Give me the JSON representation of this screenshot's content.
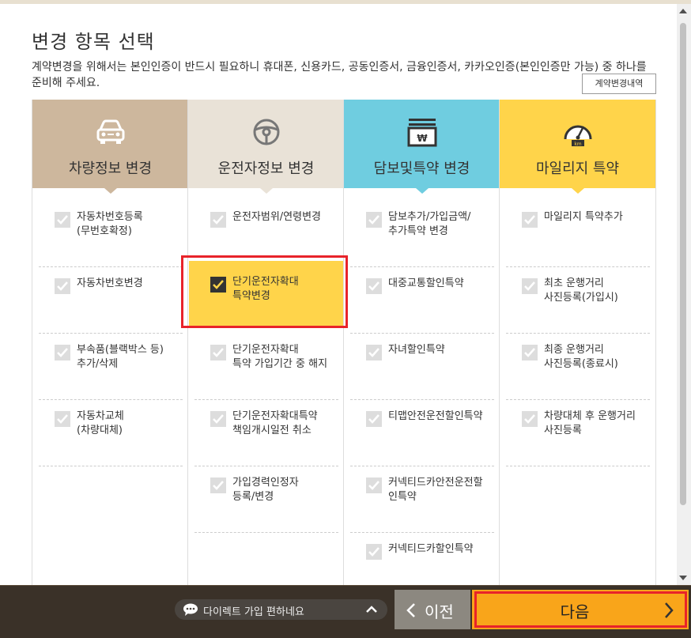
{
  "page": {
    "title": "변경 항목 선택",
    "notice": "계약변경을 위해서는 본인인증이 반드시 필요하니 휴대폰, 신용카드, 공동인증서, 금융인증서, 카카오인증(본인인증만 가능) 중 하나를 준비해 주세요.",
    "history_button": "계약변경내역"
  },
  "columns": [
    {
      "label": "차량정보 변경",
      "icon": "car-icon",
      "color": "#cdb79d",
      "items": [
        {
          "label": "자동차번호등록\n(무번호확정)",
          "checked": false
        },
        {
          "label": "자동차번호변경",
          "checked": false
        },
        {
          "label": "부속품(블랙박스 등)\n추가/삭제",
          "checked": false
        },
        {
          "label": "자동차교체\n(차량대체)",
          "checked": false
        }
      ]
    },
    {
      "label": "운전자정보 변경",
      "icon": "steering-wheel-icon",
      "color": "#e9e2d7",
      "items": [
        {
          "label": "운전자범위/연령변경",
          "checked": false
        },
        {
          "label": "단기운전자확대\n특약변경",
          "checked": true
        },
        {
          "label": "단기운전자확대\n특약 가입기간 중 해지",
          "checked": false
        },
        {
          "label": "단기운전자확대특약\n책임개시일전 취소",
          "checked": false
        },
        {
          "label": "가입경력인정자\n등록/변경",
          "checked": false
        }
      ]
    },
    {
      "label": "담보및특약 변경",
      "icon": "money-bill-icon",
      "color": "#6fcde0",
      "items": [
        {
          "label": "담보추가/가입금액/\n추가특약 변경",
          "checked": false
        },
        {
          "label": "대중교통할인특약",
          "checked": false
        },
        {
          "label": "자녀할인특약",
          "checked": false
        },
        {
          "label": "티맵안전운전할인특약",
          "checked": false
        },
        {
          "label": "커넥티드카안전운전할\n인특약",
          "checked": false
        },
        {
          "label": "커넥티드카할인특약",
          "checked": false
        }
      ]
    },
    {
      "label": "마일리지 특약",
      "icon": "speedometer-icon",
      "color": "#ffd44a",
      "items": [
        {
          "label": "마일리지 특약추가",
          "checked": false
        },
        {
          "label": "최초 운행거리\n사진등록(가입시)",
          "checked": false
        },
        {
          "label": "최종 운행거리\n사진등록(종료시)",
          "checked": false
        },
        {
          "label": "차량대체 후 운행거리\n사진등록",
          "checked": false
        }
      ]
    }
  ],
  "footer": {
    "chat_label": "다이렉트 가입 편하네요",
    "prev_label": "이전",
    "next_label": "다음"
  }
}
